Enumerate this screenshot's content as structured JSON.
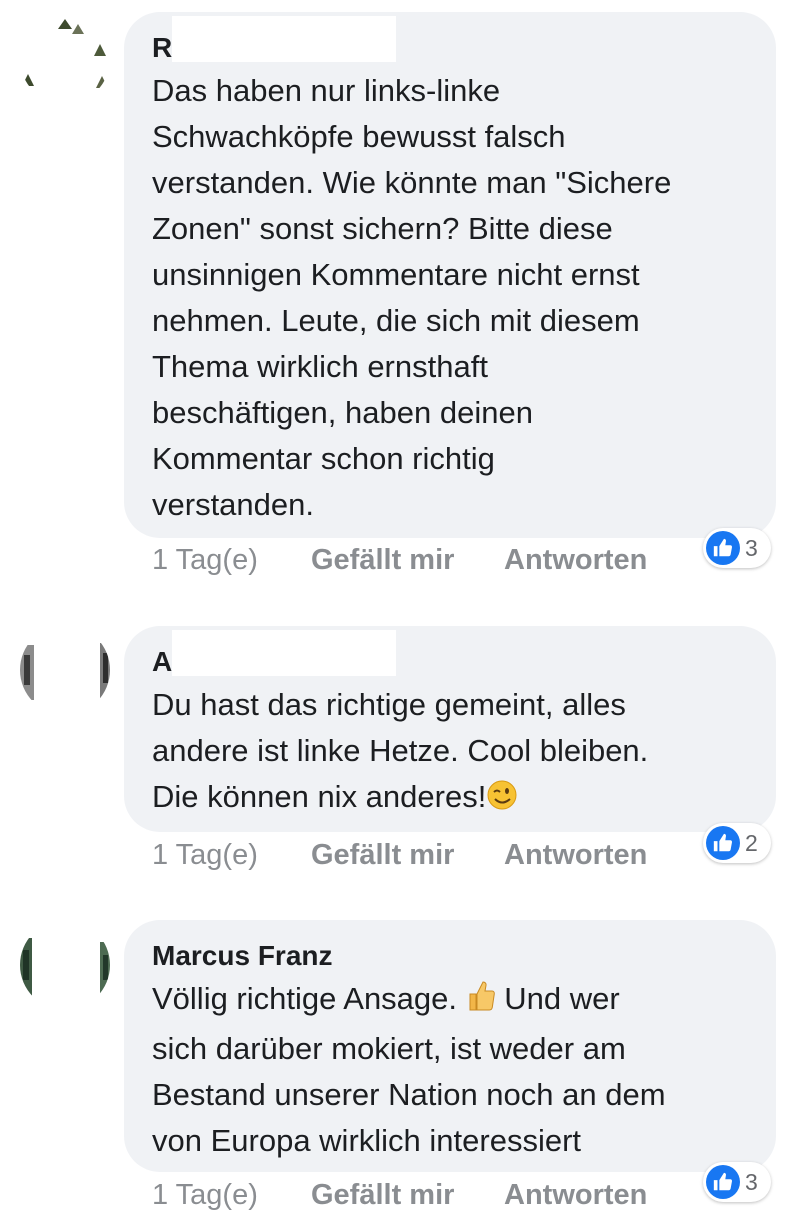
{
  "colors": {
    "bubble": "#f0f2f5",
    "like_blue": "#1877f2",
    "meta_gray": "#8a8d91",
    "text": "#1c1e21"
  },
  "comments": [
    {
      "author": "R",
      "text": "Das haben nur links-linke\nSchwachköpfe bewusst falsch\nverstanden. Wie könnte man \"Sichere\nZonen\" sonst sichern? Bitte diese\nunsinnigen Kommentare nicht ernst\nnehmen. Leute, die sich mit diesem\nThema wirklich ernsthaft\nbeschäftigen, haben deinen\nKommentar schon richtig\nverstanden.",
      "time": "1 Tag(e)",
      "like_label": "Gefällt mir",
      "reply_label": "Antworten",
      "reaction_count": "3",
      "reaction_icon": "thumbs-up-icon"
    },
    {
      "author": "A",
      "text": "Du hast das richtige gemeint, alles\nandere ist linke Hetze. Cool bleiben.\nDie können nix anderes!",
      "emoji": "winking-face-emoji",
      "time": "1 Tag(e)",
      "like_label": "Gefällt mir",
      "reply_label": "Antworten",
      "reaction_count": "2",
      "reaction_icon": "thumbs-up-icon"
    },
    {
      "author": "Marcus Franz",
      "text_before_emoji": "Völlig richtige Ansage.",
      "emoji": "thumbs-up-emoji",
      "text_after_emoji": " Und wer\nsich darüber mokiert, ist weder am\nBestand unserer Nation noch an dem\nvon Europa wirklich interessiert",
      "time": "1 Tag(e)",
      "like_label": "Gefällt mir",
      "reply_label": "Antworten",
      "reaction_count": "3",
      "reaction_icon": "thumbs-up-icon"
    }
  ]
}
